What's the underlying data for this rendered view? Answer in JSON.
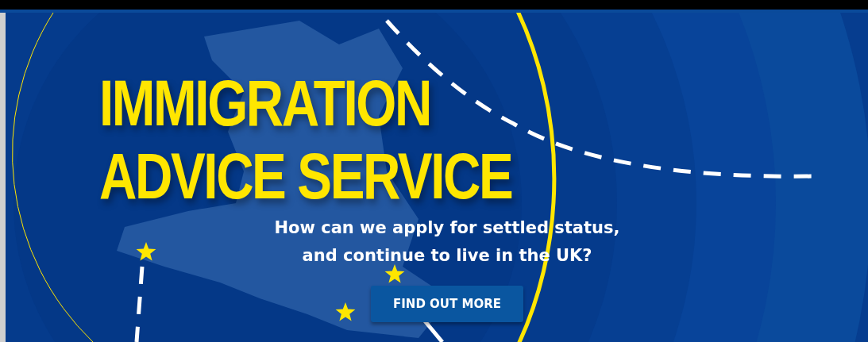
{
  "banner": {
    "title_lines": [
      "IMMIGRATION",
      "ADVICE SERVICE"
    ],
    "subtitle_lines": [
      "How can we apply for settled status,",
      "and continue to live in the UK?"
    ],
    "button": "FIND OUT MORE"
  }
}
